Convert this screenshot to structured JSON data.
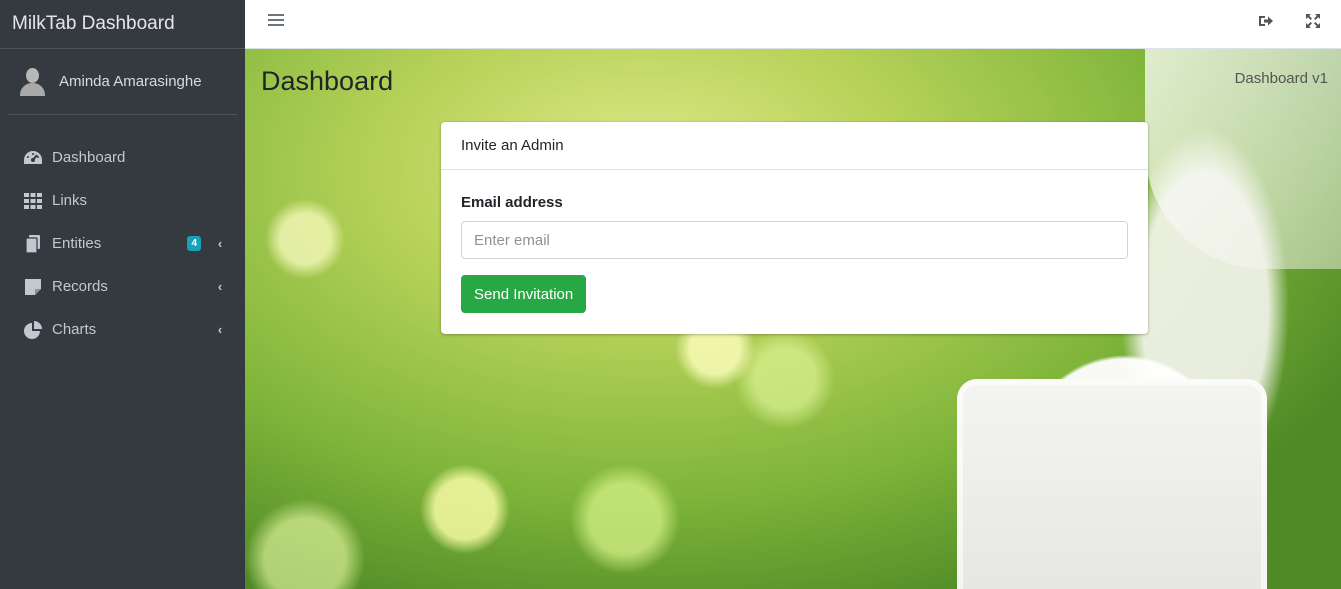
{
  "brand": {
    "title": "MilkTab Dashboard"
  },
  "user": {
    "name": "Aminda Amarasinghe"
  },
  "sidebar": {
    "items": [
      {
        "label": "Dashboard",
        "icon": "tachometer-icon"
      },
      {
        "label": "Links",
        "icon": "grid-icon"
      },
      {
        "label": "Entities",
        "icon": "copy-icon",
        "badge": "4"
      },
      {
        "label": "Records",
        "icon": "sticky-note-icon"
      },
      {
        "label": "Charts",
        "icon": "pie-chart-icon"
      }
    ]
  },
  "topbar": {
    "icons": [
      "hamburger-menu-icon",
      "sign-out-icon",
      "expand-icon"
    ]
  },
  "content": {
    "page_title": "Dashboard",
    "breadcrumb": "Dashboard v1"
  },
  "invite_card": {
    "header": "Invite an Admin",
    "email_label": "Email address",
    "email_placeholder": "Enter email",
    "email_value": "",
    "submit_label": "Send Invitation"
  },
  "colors": {
    "sidebar_bg": "#343a40",
    "badge_bg": "#17a2b8",
    "button_bg": "#28a745"
  }
}
